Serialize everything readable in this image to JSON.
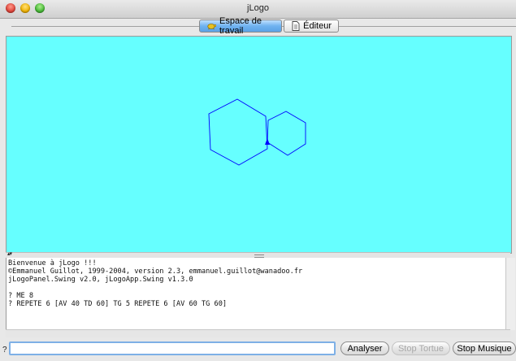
{
  "window": {
    "title": "jLogo"
  },
  "tabs": [
    {
      "label": "Espace de travail",
      "icon": "turtle-icon",
      "active": true
    },
    {
      "label": "Éditeur",
      "icon": "document-icon",
      "active": false
    }
  ],
  "canvas": {
    "background": "#66ffff",
    "stroke": "#0000ff",
    "turtle_color": "#0000ff"
  },
  "console": {
    "lines": [
      "Bienvenue à jLogo !!!",
      "©Emmanuel Guillot, 1999-2004, version 2.3, emmanuel.guillot@wanadoo.fr",
      "jLogoPanel.Swing v2.0, jLogoApp.Swing v1.3.0",
      "",
      "? ME 8",
      "? REPETE 6 [AV 40 TD 60] TG 5 REPETE 6 [AV 60 TG 60]"
    ]
  },
  "command": {
    "prompt": "?",
    "value": ""
  },
  "buttons": {
    "analyze": "Analyser",
    "stop_turtle": "Stop Tortue",
    "stop_music": "Stop Musique"
  }
}
